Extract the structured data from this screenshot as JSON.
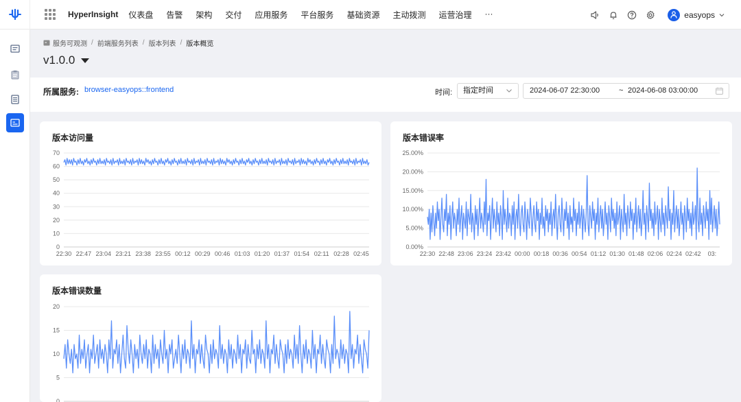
{
  "topbar": {
    "brand": "HyperInsight",
    "menu": [
      "仪表盘",
      "告警",
      "架构",
      "交付",
      "应用服务",
      "平台服务",
      "基础资源",
      "主动拨测",
      "运营治理",
      "···"
    ],
    "user": "easyops",
    "icons": [
      "speaker-icon",
      "bell-icon",
      "help-icon",
      "gear-icon"
    ]
  },
  "sidebar": {
    "icons": [
      "list-icon",
      "clipboard-icon",
      "document-icon",
      "terminal-icon"
    ],
    "active": 3
  },
  "breadcrumb": {
    "items": [
      "服务可观测",
      "前端服务列表",
      "版本列表",
      "版本概览"
    ],
    "separator": "/"
  },
  "version": "v1.0.0",
  "filter": {
    "service_label": "所属服务:",
    "service_name": "browser-easyops::frontend",
    "time_label": "时间:",
    "time_mode": "指定时间",
    "start": "2024-06-07 22:30:00",
    "range_separator": "~",
    "end": "2024-06-08 03:00:00"
  },
  "colors": {
    "accent": "#1a66f0",
    "series": "#5b8ff9"
  },
  "chart_data": [
    {
      "title": "版本访问量",
      "type": "line",
      "ylim": [
        0,
        70
      ],
      "yticks": [
        "0",
        "10",
        "20",
        "30",
        "40",
        "50",
        "60",
        "70"
      ],
      "xticks": [
        "22:30",
        "22:47",
        "23:04",
        "23:21",
        "23:38",
        "23:55",
        "00:12",
        "00:29",
        "00:46",
        "01:03",
        "01:20",
        "01:37",
        "01:54",
        "02:11",
        "02:28",
        "02:45"
      ],
      "grid": true,
      "values": [
        63,
        65,
        61,
        66,
        62,
        65,
        62,
        65,
        61,
        66,
        63,
        64,
        61,
        65,
        62,
        66,
        62,
        64,
        61,
        65,
        63,
        66,
        62,
        64,
        61,
        65,
        62,
        66,
        63,
        64,
        61,
        65,
        62,
        66,
        62,
        64,
        62,
        65,
        61,
        66,
        63,
        64,
        62,
        65,
        61,
        66,
        62,
        64,
        63,
        65,
        61,
        66,
        62,
        64,
        62,
        65,
        61,
        66,
        63,
        64,
        62,
        65,
        61,
        66,
        62,
        64,
        63,
        65,
        61,
        66,
        62,
        65,
        62,
        64,
        61,
        66,
        63,
        65,
        62,
        64,
        61,
        65,
        62,
        66,
        63,
        64,
        61,
        65,
        62,
        66,
        62,
        64,
        61,
        65,
        63,
        66,
        62,
        64,
        61,
        65,
        62,
        66,
        63,
        64,
        61,
        65,
        62,
        66,
        62,
        64,
        62,
        65,
        61,
        66,
        63,
        64,
        62,
        65,
        61,
        66,
        62,
        64,
        63,
        65,
        61,
        66,
        62,
        64,
        62,
        65,
        61,
        66,
        63,
        64,
        62,
        65,
        61,
        66,
        62,
        64,
        63,
        65,
        61,
        66,
        62,
        65,
        62,
        64,
        61,
        66,
        63,
        65,
        62,
        64,
        61,
        65,
        62,
        66,
        63,
        64,
        61,
        65,
        62,
        66,
        62,
        64,
        61,
        65,
        63,
        66,
        62,
        64,
        61,
        65,
        62,
        66,
        63,
        64,
        61,
        65,
        62,
        66,
        62,
        64,
        62,
        65,
        61,
        66,
        63,
        64,
        62,
        65,
        61,
        66,
        62,
        64,
        63,
        65,
        61,
        66,
        62,
        64,
        62,
        65,
        61,
        66,
        63,
        64,
        62,
        65,
        61,
        66,
        62,
        64,
        63,
        65,
        61,
        66,
        62,
        65,
        62,
        64,
        61,
        66,
        63,
        65,
        62,
        64,
        61,
        65,
        62,
        66,
        63,
        64,
        61,
        65,
        62,
        66,
        62,
        64,
        61,
        65,
        63,
        66,
        62,
        64,
        61,
        65,
        62,
        66,
        63,
        64,
        61,
        65,
        62,
        66,
        62,
        64,
        62,
        65,
        61,
        66,
        63,
        64,
        62,
        65,
        61,
        66,
        62,
        64,
        63,
        65,
        61,
        66,
        62,
        64,
        62,
        65,
        61,
        63
      ]
    },
    {
      "title": "版本错误率",
      "type": "line",
      "ylim": [
        0,
        25
      ],
      "yticks": [
        "0.00%",
        "5.00%",
        "10.00%",
        "15.00%",
        "20.00%",
        "25.00%"
      ],
      "xticks": [
        "22:30",
        "22:48",
        "23:06",
        "23:24",
        "23:42",
        "00:00",
        "00:18",
        "00:36",
        "00:54",
        "01:12",
        "01:30",
        "01:48",
        "02:06",
        "02:24",
        "02:42",
        "03:"
      ],
      "grid": true,
      "values": [
        8,
        6,
        10,
        2,
        9,
        4,
        11,
        7,
        3,
        9,
        5,
        12,
        7,
        10,
        2,
        8,
        13,
        6,
        4,
        10,
        7,
        14,
        3,
        9,
        6,
        11,
        2,
        8,
        12,
        5,
        9,
        7,
        3,
        10,
        6,
        13,
        4,
        8,
        11,
        2,
        9,
        7,
        5,
        12,
        3,
        10,
        8,
        6,
        14,
        4,
        9,
        7,
        2,
        11,
        6,
        10,
        3,
        8,
        13,
        5,
        9,
        7,
        4,
        12,
        6,
        18,
        3,
        9,
        7,
        11,
        2,
        8,
        13,
        5,
        10,
        7,
        4,
        12,
        6,
        9,
        3,
        11,
        8,
        2,
        15,
        6,
        10,
        7,
        4,
        13,
        5,
        9,
        8,
        3,
        11,
        6,
        12,
        2,
        8,
        10,
        5,
        14,
        7,
        3,
        9,
        11,
        6,
        4,
        12,
        8,
        2,
        10,
        7,
        5,
        13,
        9,
        3,
        8,
        11,
        6,
        4,
        12,
        7,
        10,
        2,
        9,
        6,
        13,
        5,
        8,
        3,
        11,
        7,
        10,
        4,
        9,
        6,
        12,
        3,
        8,
        10,
        5,
        14,
        7,
        2,
        9,
        11,
        6,
        4,
        13,
        8,
        3,
        10,
        7,
        12,
        5,
        9,
        2,
        11,
        6,
        8,
        4,
        13,
        7,
        10,
        3,
        9,
        6,
        12,
        5,
        8,
        11,
        2,
        10,
        7,
        4,
        9,
        19,
        6,
        3,
        11,
        8,
        5,
        12,
        7,
        10,
        2,
        9,
        6,
        13,
        4,
        8,
        11,
        5,
        10,
        3,
        7,
        12,
        6,
        9,
        2,
        11,
        8,
        4,
        13,
        7,
        10,
        5,
        9,
        3,
        12,
        6,
        8,
        11,
        2,
        10,
        7,
        4,
        14,
        6,
        9,
        3,
        11,
        8,
        5,
        12,
        7,
        10,
        2,
        9,
        6,
        13,
        4,
        8,
        11,
        5,
        10,
        3,
        7,
        15,
        6,
        9,
        2,
        11,
        8,
        4,
        17,
        7,
        10,
        5,
        9,
        3,
        12,
        6,
        8,
        11,
        2,
        10,
        7,
        4,
        13,
        6,
        9,
        3,
        11,
        8,
        5,
        16,
        7,
        10,
        2,
        9,
        6,
        15,
        4,
        8,
        11,
        5,
        10,
        3,
        7,
        12,
        6,
        9,
        2,
        11,
        8,
        4,
        13,
        7,
        10,
        5,
        9,
        3,
        12,
        6,
        8,
        11,
        2,
        21,
        7,
        4,
        13,
        6,
        9,
        3,
        11,
        8,
        5,
        12,
        7,
        10,
        2,
        15,
        6,
        13,
        4,
        8,
        11,
        5,
        10,
        3,
        7,
        12,
        6
      ]
    },
    {
      "title": "版本错误数量",
      "type": "line",
      "ylim": [
        0,
        20
      ],
      "yticks": [
        "0",
        "5",
        "10",
        "15",
        "20"
      ],
      "grid": true,
      "values": [
        9,
        12,
        7,
        13,
        10,
        8,
        11,
        6,
        12,
        9,
        10,
        7,
        14,
        8,
        11,
        9,
        13,
        7,
        10,
        12,
        6,
        11,
        9,
        14,
        8,
        10,
        12,
        7,
        13,
        9,
        11,
        8,
        12,
        10,
        6,
        13,
        9,
        17,
        7,
        11,
        10,
        13,
        8,
        12,
        6,
        10,
        14,
        9,
        7,
        16,
        11,
        8,
        13,
        10,
        6,
        12,
        9,
        11,
        7,
        14,
        10,
        8,
        12,
        9,
        13,
        7,
        11,
        10,
        6,
        14,
        8,
        12,
        9,
        11,
        7,
        13,
        10,
        8,
        15,
        9,
        11,
        6,
        12,
        10,
        13,
        7,
        9,
        11,
        8,
        14,
        10,
        6,
        12,
        9,
        13,
        8,
        11,
        10,
        7,
        17,
        9,
        12,
        6,
        11,
        10,
        13,
        8,
        12,
        9,
        7,
        14,
        11,
        10,
        6,
        12,
        8,
        13,
        9,
        11,
        10,
        7,
        16,
        9,
        12,
        8,
        11,
        10,
        6,
        13,
        9,
        12,
        7,
        11,
        10,
        8,
        14,
        9,
        12,
        6,
        11,
        10,
        13,
        7,
        12,
        9,
        8,
        15,
        10,
        11,
        6,
        12,
        9,
        13,
        8,
        11,
        10,
        7,
        17,
        9,
        12,
        6,
        11,
        10,
        14,
        8,
        12,
        9,
        7,
        13,
        11,
        10,
        6,
        12,
        8,
        13,
        9,
        11,
        10,
        7,
        14,
        9,
        12,
        8,
        16,
        10,
        6,
        12,
        9,
        13,
        8,
        11,
        10,
        7,
        15,
        9,
        12,
        6,
        11,
        10,
        14,
        8,
        12,
        9,
        7,
        13,
        11,
        10,
        6,
        12,
        8,
        18,
        9,
        11,
        10,
        7,
        13,
        9,
        12,
        8,
        11,
        10,
        6,
        19,
        9,
        12,
        7,
        11,
        10,
        14,
        8,
        12,
        9,
        6,
        13,
        11,
        10,
        7,
        15
      ]
    }
  ]
}
